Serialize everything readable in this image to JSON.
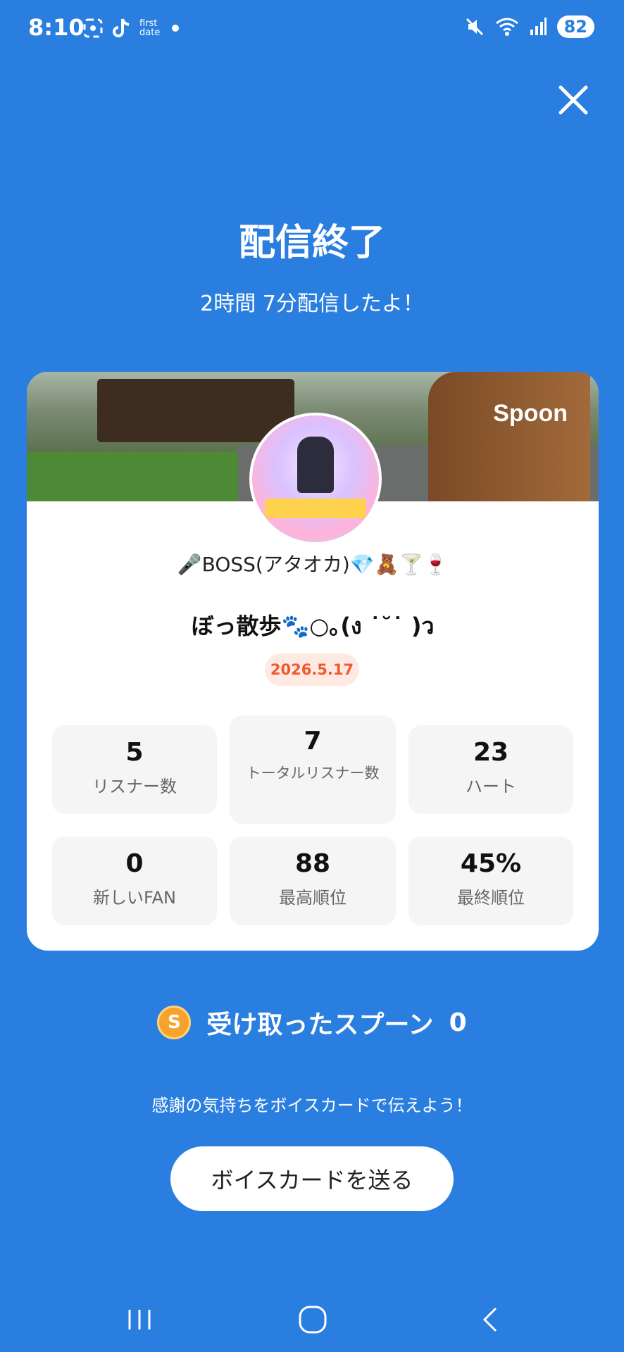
{
  "status_bar": {
    "time": "8:10",
    "app_label": "first\ndate",
    "battery": "82",
    "icons": [
      "screenshot-icon",
      "tiktok-icon",
      "dot-icon",
      "mute-icon",
      "wifi-icon",
      "signal-icon"
    ]
  },
  "header": {
    "title": "配信終了",
    "subtitle": "2時間 7分配信したよ！"
  },
  "card": {
    "brand": "Spoon",
    "host_name": "🎤BOSS(アタオカ)💎🧸🍸🍷",
    "live_title": "ぼっ散歩🐾○｡(ง ˙˘˙ )ว",
    "date": "2026.5.17",
    "stats": [
      {
        "value": "5",
        "label": "リスナー数"
      },
      {
        "value": "7",
        "label": "トータルリスナー数"
      },
      {
        "value": "23",
        "label": "ハート"
      },
      {
        "value": "0",
        "label": "新しいFAN"
      },
      {
        "value": "88",
        "label": "最高順位"
      },
      {
        "value": "45%",
        "label": "最終順位"
      }
    ]
  },
  "spoons": {
    "coin": "S",
    "label": "受け取ったスプーン",
    "count": "0"
  },
  "thanks_text": "感謝の気持ちをボイスカードで伝えよう！",
  "voice_card_button": "ボイスカードを送る"
}
